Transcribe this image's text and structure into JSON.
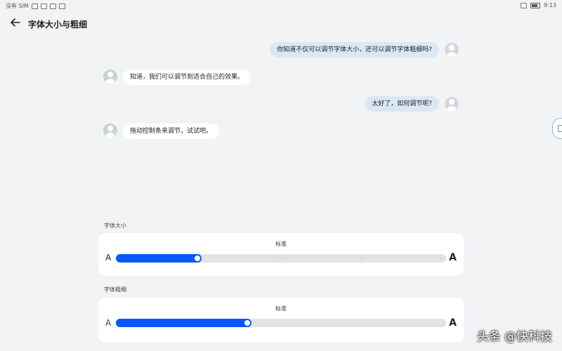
{
  "statusbar": {
    "carrier": "没有 SIM",
    "time": "9:13"
  },
  "header": {
    "title": "字体大小与粗细"
  },
  "messages": [
    {
      "side": "right",
      "text": "你知道不仅可以调节字体大小，还可以调节字体粗细吗?"
    },
    {
      "side": "left",
      "text": "知道，我们可以调节到适合自己的效果。"
    },
    {
      "side": "right",
      "text": "太好了，如何调节呢?"
    },
    {
      "side": "left",
      "text": "拖动控制条来调节，试试吧。"
    }
  ],
  "font_size": {
    "label": "字体大小",
    "value_label": "标准",
    "small_glyph": "A",
    "large_glyph": "A",
    "level_fraction": 0.26
  },
  "font_weight": {
    "label": "字体粗细",
    "value_label": "标准",
    "small_glyph": "A",
    "large_glyph": "A",
    "level_fraction": 0.41
  },
  "watermark": "头条 @快科技",
  "colors": {
    "accent": "#0a59f7",
    "bubble_right": "#dbe8f3",
    "background": "#f1f3f5"
  },
  "icons": {
    "back": "arrow-left-icon",
    "avatar": "person-avatar-icon",
    "floating": "floating-window-icon"
  }
}
